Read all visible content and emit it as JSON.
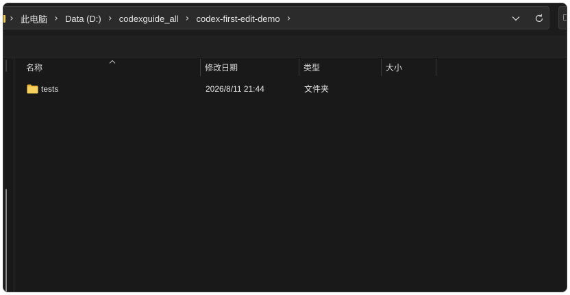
{
  "breadcrumb": {
    "items": [
      "此电脑",
      "Data (D:)",
      "codexguide_all",
      "codex-first-edit-demo"
    ],
    "separator": "›"
  },
  "address_bar": {
    "dropdown_icon": "chevron-down-icon",
    "refresh_icon": "refresh-icon"
  },
  "columns": {
    "name": "名称",
    "date_modified": "修改日期",
    "type": "类型",
    "size": "大小",
    "sort_indicator": "sort-ascending-icon"
  },
  "files": [
    {
      "name": "tests",
      "date_modified": "2026/8/11 21:44",
      "type": "文件夹",
      "size": "",
      "icon": "folder-icon"
    }
  ],
  "colors": {
    "background": "#191919",
    "address_bar": "#2b2b2b",
    "folder": "#f2c94c",
    "text": "#e6e6e6"
  }
}
